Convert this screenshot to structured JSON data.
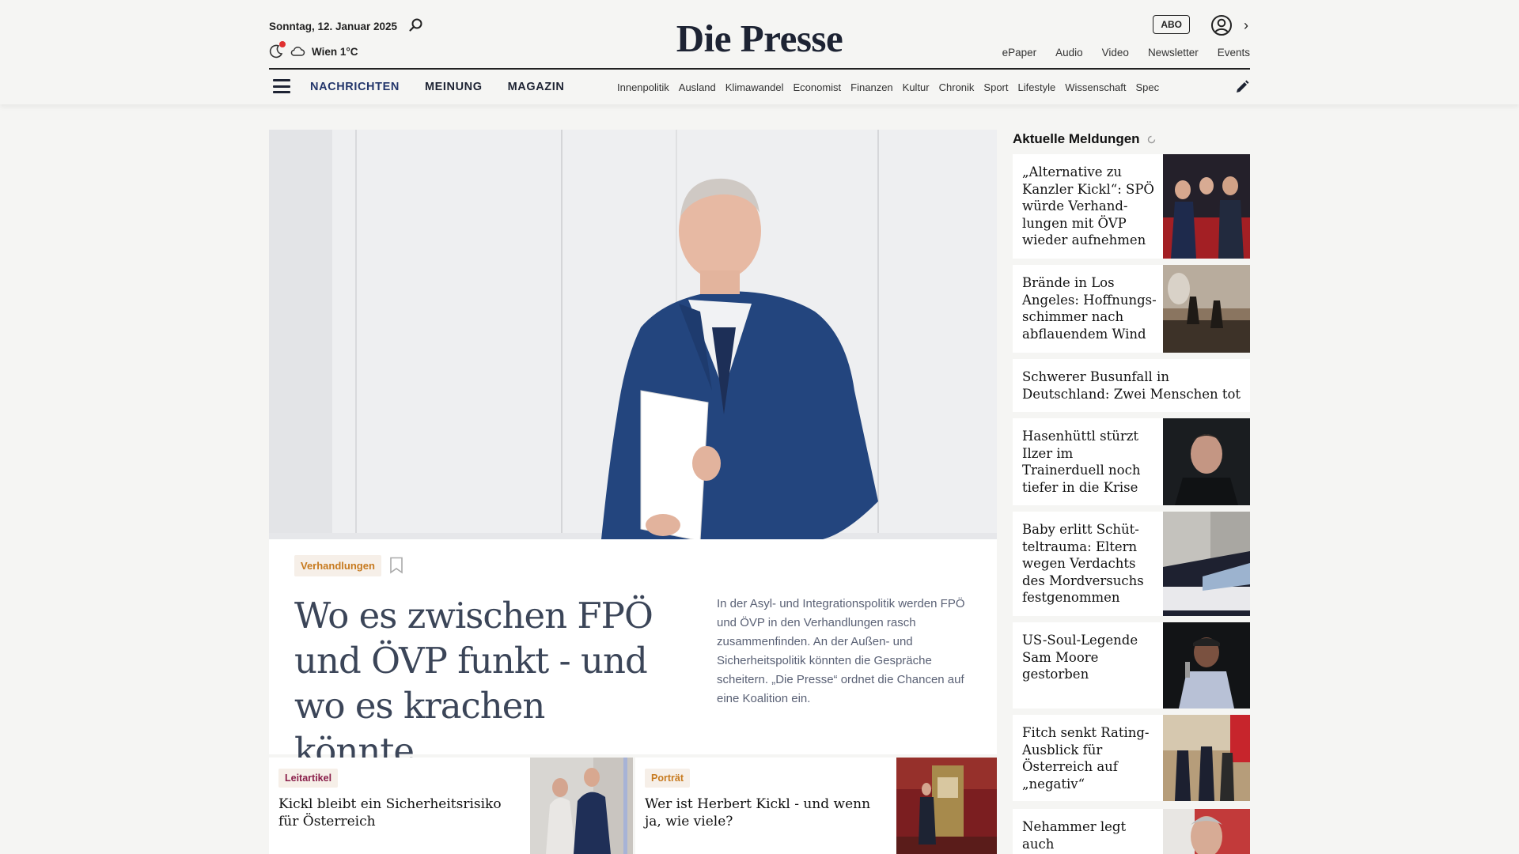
{
  "header": {
    "date": "Sonntag, 12. Januar 2025",
    "weather": "Wien 1°C",
    "logo": "Die Presse",
    "abo": "ABO",
    "top_links": [
      "ePaper",
      "Audio",
      "Video",
      "Newsletter",
      "Events"
    ],
    "main_nav": [
      "NACHRICHTEN",
      "MEINUNG",
      "MAGAZIN"
    ],
    "sub_nav": [
      "Innenpolitik",
      "Ausland",
      "Klimawandel",
      "Economist",
      "Finanzen",
      "Kultur",
      "Chronik",
      "Sport",
      "Lifestyle",
      "Wissenschaft",
      "Spec"
    ]
  },
  "hero": {
    "tag": "Verhandlungen",
    "headline": "Wo es zwischen FPÖ und ÖVP funkt - und wo es krachen könnte",
    "teaser": "In der Asyl- und Integrationspolitik werden FPÖ und ÖVP in den Verhandlungen rasch zusammenfinden. An der Außen- und Sicherheitspolitik könnten die Gespräche scheitern. „Die Presse“ ordnet die Chancen auf eine Koalition ein."
  },
  "cards": [
    {
      "tag": "Leitartikel",
      "title": "Kickl bleibt ein Sicherheitsrisiko für Österreich",
      "tag_color": "#8a1f4a"
    },
    {
      "tag": "Porträt",
      "title": "Wer ist Herbert Kickl - und wenn ja, wie viele?",
      "tag_color": "#c77a1f"
    }
  ],
  "sidebar": {
    "title": "Aktuelle Meldungen",
    "items": [
      {
        "text": "„Alternative zu Kanzler Kickl“: SPÖ würde Verhand-lungen mit ÖVP wieder aufnehmen"
      },
      {
        "text": "Brände in Los Angeles: Hoffnungs-schimmer nach abflauendem Wind"
      },
      {
        "text": "Schwerer Busunfall in Deutschland: Zwei Menschen tot"
      },
      {
        "text": "Hasenhüttl stürzt Ilzer im Trainerduell noch tiefer in die Krise"
      },
      {
        "text": "Baby erlitt Schüt-teltrauma: Eltern wegen Verdachts des Mordversuchs festgenommen"
      },
      {
        "text": "US-Soul-Legende Sam Moore gestorben"
      },
      {
        "text": "Fitch senkt Rating-Ausblick für Österreich auf „negativ“"
      },
      {
        "text": "Nehammer legt auch Nationalratsmandat"
      }
    ]
  }
}
